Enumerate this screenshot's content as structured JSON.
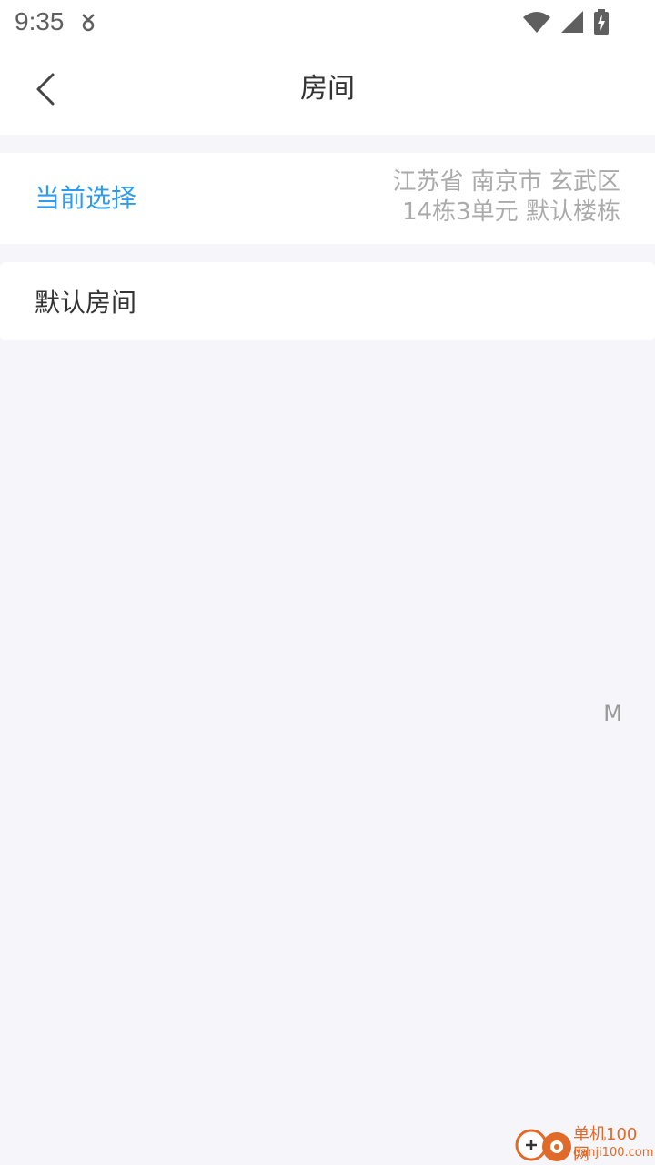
{
  "status_bar": {
    "time": "9:35",
    "left_icon": "notification-icon",
    "right_icons": [
      "wifi-icon",
      "signal-icon",
      "battery-charging-icon"
    ]
  },
  "header": {
    "back_icon": "back-arrow-icon",
    "title": "房间"
  },
  "current_selection": {
    "label": "当前选择",
    "line1": "江苏省 南京市 玄武区",
    "line2": "14栋3单元 默认楼栋"
  },
  "rooms": [
    {
      "label": "默认房间"
    }
  ],
  "side_index": {
    "letter": "M"
  },
  "watermark": {
    "title": "单机100网",
    "url": "danji100.com"
  },
  "colors": {
    "accent": "#2f9bef",
    "background": "#f5f5fa",
    "muted_text": "#aaaaaa"
  }
}
